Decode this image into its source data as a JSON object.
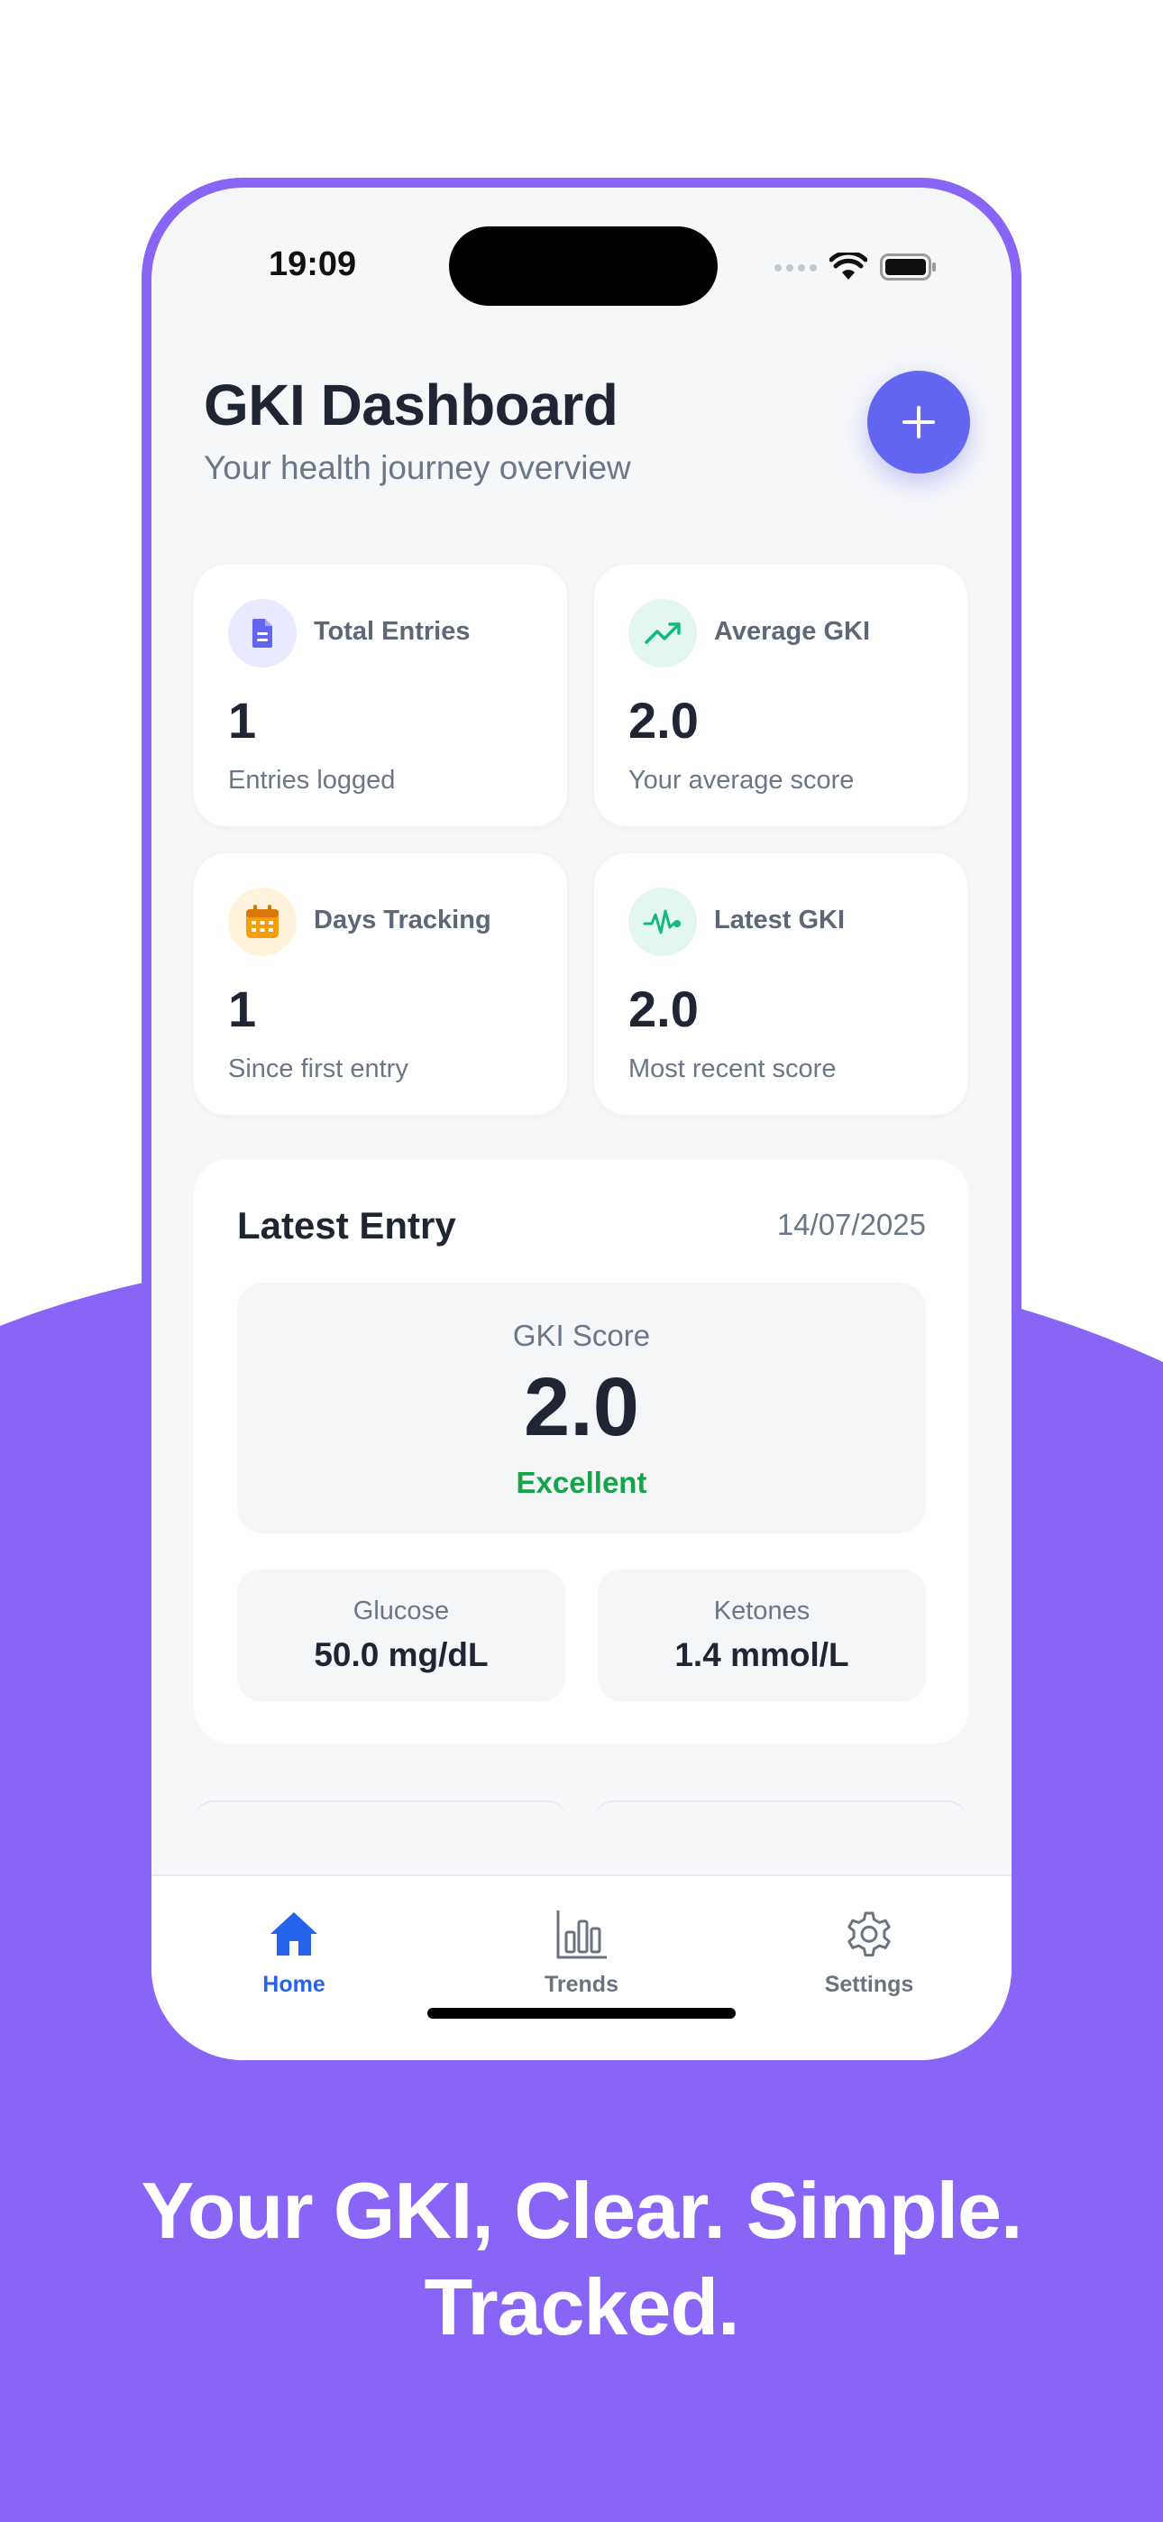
{
  "status_bar": {
    "time": "19:09"
  },
  "header": {
    "title": "GKI Dashboard",
    "subtitle": "Your health journey overview",
    "add_icon": "plus-icon"
  },
  "stats": [
    {
      "label": "Total Entries",
      "value": "1",
      "desc": "Entries logged",
      "icon": "document-icon",
      "icon_color": "#6366f1",
      "icon_bg": "#e9eaff"
    },
    {
      "label": "Average GKI",
      "value": "2.0",
      "desc": "Your average score",
      "icon": "trending-up-icon",
      "icon_color": "#10b981",
      "icon_bg": "#e3f7ee"
    },
    {
      "label": "Days Tracking",
      "value": "1",
      "desc": "Since first entry",
      "icon": "calendar-icon",
      "icon_color": "#f59e0b",
      "icon_bg": "#fff3dc"
    },
    {
      "label": "Latest GKI",
      "value": "2.0",
      "desc": "Most recent score",
      "icon": "activity-icon",
      "icon_color": "#10b981",
      "icon_bg": "#e3f7ee"
    }
  ],
  "latest_entry": {
    "title": "Latest Entry",
    "date": "14/07/2025",
    "score_label": "GKI Score",
    "score_value": "2.0",
    "rating": "Excellent",
    "glucose_label": "Glucose",
    "glucose_value": "50.0 mg/dL",
    "ketones_label": "Ketones",
    "ketones_value": "1.4 mmol/L"
  },
  "tabs": [
    {
      "label": "Home",
      "icon": "home-icon",
      "active": true
    },
    {
      "label": "Trends",
      "icon": "bar-chart-icon",
      "active": false
    },
    {
      "label": "Settings",
      "icon": "gear-icon",
      "active": false
    }
  ],
  "tagline": {
    "line1": "Your GKI, Clear. Simple.",
    "line2": "Tracked."
  },
  "colors": {
    "brand_purple": "#8865f7",
    "accent_indigo": "#6366f1",
    "active_tab": "#2563eb",
    "inactive_tab": "#6b7280",
    "rating_green": "#16a34a"
  }
}
